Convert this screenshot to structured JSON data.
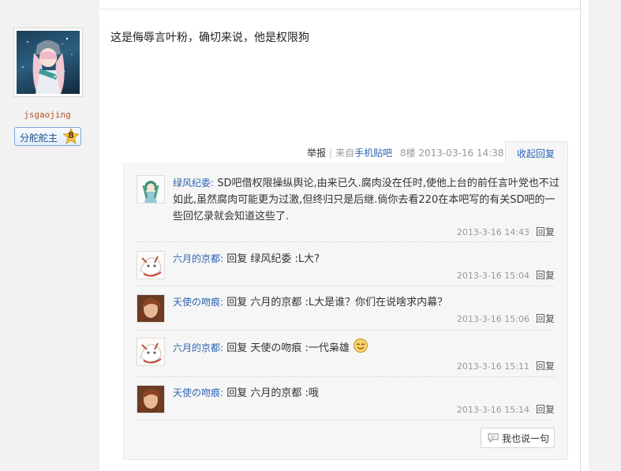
{
  "post": {
    "username": "jsgaojing",
    "badge_label": "分舵舵主",
    "badge_level": "8",
    "content": "这是侮辱言叶粉，确切来说，他是权限狗",
    "report": "举报",
    "source_prefix": "来自",
    "source_link": "手机贴吧",
    "floor": "8楼",
    "time": "2013-03-16 14:38",
    "collapse_label": "收起回复"
  },
  "replies": [
    {
      "user": "绿风纪委:",
      "text": "SD吧借权限操纵舆论,由来已久.腐肉没在任时,使他上台的前任言叶党也不过如此,虽然腐肉可能更为过激,但终归只是后继.倘你去看220在本吧写的有关SD吧的一些回忆录就会知道这些了.",
      "time": "2013-3-16 14:43",
      "reply_label": "回复"
    },
    {
      "user": "六月的京都:",
      "text": "回复 绿风纪委 :L大?",
      "time": "2013-3-16 15:04",
      "reply_label": "回复"
    },
    {
      "user": "天使の吻痕:",
      "text": "回复 六月的京都 :L大是谁？你们在说啥求内幕？",
      "time": "2013-3-16 15:06",
      "reply_label": "回复"
    },
    {
      "user": "六月的京都:",
      "text": "回复 天使の吻痕 :一代枭雄",
      "time": "2013-3-16 15:11",
      "reply_label": "回复"
    },
    {
      "user": "天使の吻痕:",
      "text": "回复 六月的京都 :哦",
      "time": "2013-3-16 15:14",
      "reply_label": "回复"
    }
  ],
  "say_button": "我也说一句",
  "icons": {
    "badge": "star-badge-icon",
    "emoji": "smiley-emoji-icon",
    "say": "speech-bubble-icon"
  },
  "colors": {
    "link": "#2d64b3",
    "username": "#b2522a",
    "sidebar": "#f2f2f2"
  }
}
